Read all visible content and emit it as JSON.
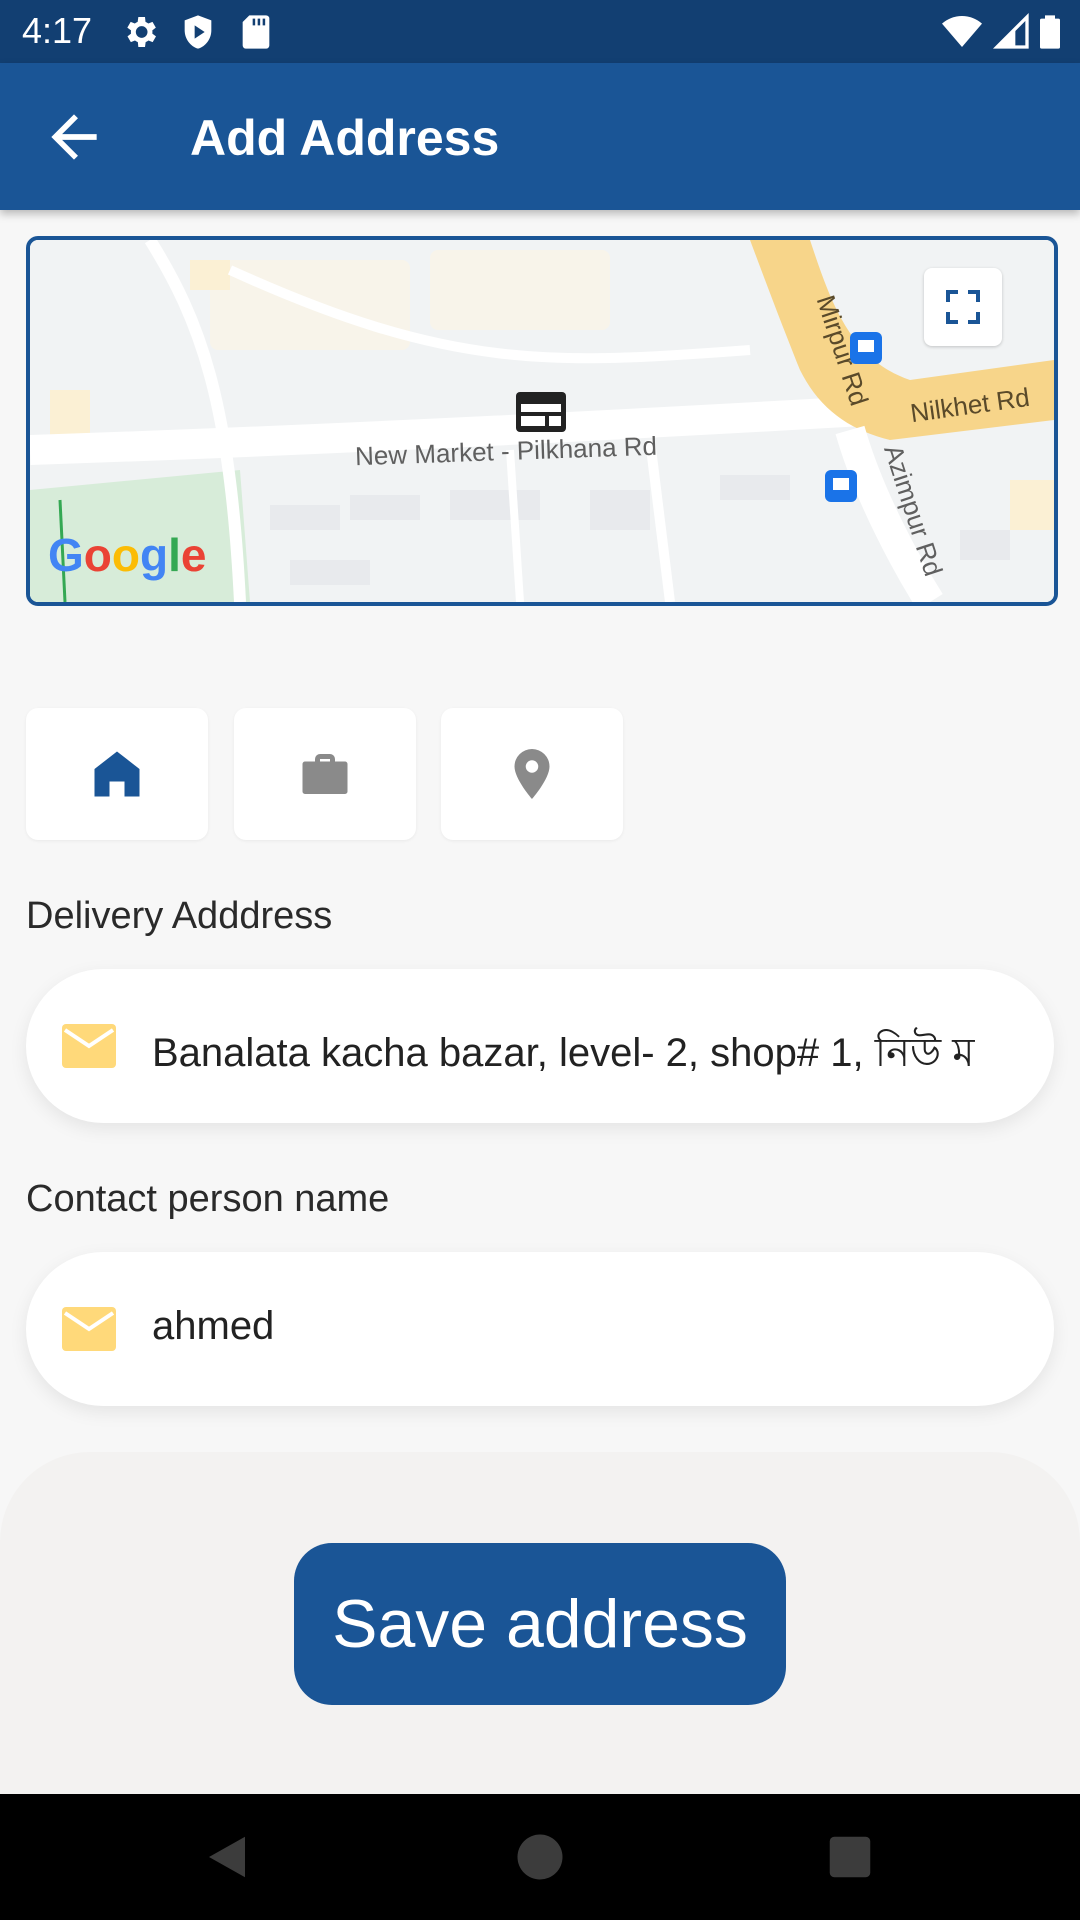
{
  "status_bar": {
    "time": "4:17",
    "left_icons": [
      "settings-icon",
      "shield-icon",
      "sd-card-icon"
    ],
    "right_icons": [
      "wifi-icon",
      "signal-icon",
      "battery-icon"
    ]
  },
  "app_bar": {
    "back_icon": "arrow-back-icon",
    "title": "Add Address"
  },
  "map": {
    "road_labels": {
      "new_market": "New Market - Pilkhana Rd",
      "mirpur": "Mirpur Rd",
      "nilkhet": "Nilkhet Rd",
      "azimpur": "Azimpur Rd"
    },
    "attribution": "Google",
    "fullscreen_icon": "fullscreen-icon",
    "marker_icon": "map-marker-icon"
  },
  "address_types": [
    {
      "icon": "home-icon",
      "selected": true
    },
    {
      "icon": "briefcase-icon",
      "selected": false
    },
    {
      "icon": "location-pin-icon",
      "selected": false
    }
  ],
  "form": {
    "delivery_label": "Delivery Adddress",
    "delivery_value": "Banalata kacha bazar, level- 2, shop# 1, নিউ ম",
    "contact_label": "Contact person name",
    "contact_value": "ahmed",
    "field_icon": "mail-icon"
  },
  "save_button": {
    "label": "Save address"
  },
  "colors": {
    "primary": "#1a5596",
    "status_bar": "#123f72",
    "accent_icon": "#ffd97a",
    "road_highlight": "#f7d58a"
  },
  "nav_bar": {
    "buttons": [
      "back-nav-icon",
      "home-nav-icon",
      "recents-nav-icon"
    ]
  }
}
